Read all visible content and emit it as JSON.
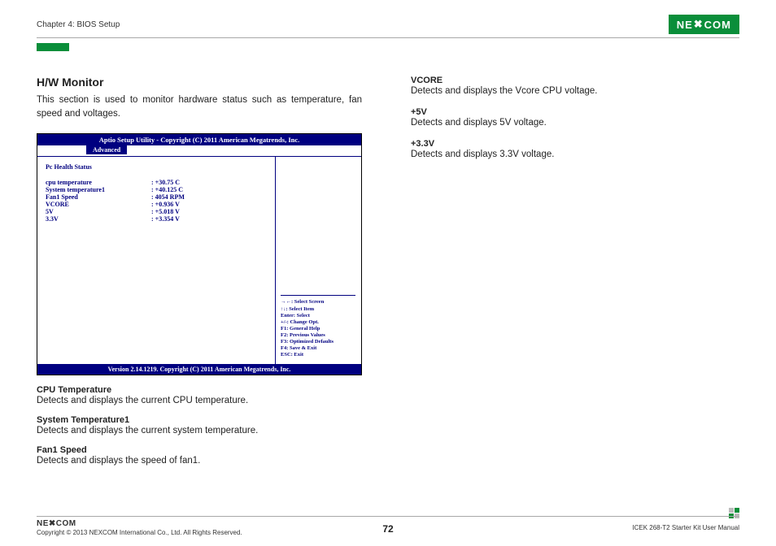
{
  "header": {
    "chapter": "Chapter 4: BIOS Setup",
    "logo_text": "NE COM",
    "logo_x": "✖"
  },
  "main": {
    "section_title": "H/W Monitor",
    "intro": "This section is used to monitor hardware status such as temperature, fan speed and voltages."
  },
  "bios": {
    "title": "Aptio Setup Utility - Copyright (C) 2011 American Megatrends, Inc.",
    "tab": "Advanced",
    "status_header": "Pc Health Status",
    "rows": [
      {
        "label": "cpu temperature",
        "value": ":  +30.75 C"
      },
      {
        "label": "System temperature1",
        "value": ":  +40.125 C"
      },
      {
        "label": "Fan1 Speed",
        "value": ":  4054 RPM"
      },
      {
        "label": "VCORE",
        "value": ":  +0.936 V"
      },
      {
        "label": "5V",
        "value": ":  +5.018 V"
      },
      {
        "label": "3.3V",
        "value": ":  +3.354 V"
      }
    ],
    "help": [
      "→←: Select Screen",
      "↑↓: Select Item",
      "Enter: Select",
      "+/-: Change Opt.",
      "F1: General Help",
      "F2: Previous Values",
      "F3: Optimized Defaults",
      "F4: Save & Exit",
      "ESC: Exit"
    ],
    "footer": "Version 2.14.1219. Copyright (C) 2011 American Megatrends, Inc."
  },
  "fields_left": [
    {
      "title": "CPU Temperature",
      "desc": "Detects and displays the current CPU temperature."
    },
    {
      "title": "System Temperature1",
      "desc": "Detects and displays the current system temperature."
    },
    {
      "title": "Fan1 Speed",
      "desc": "Detects and displays the speed of fan1."
    }
  ],
  "fields_right": [
    {
      "title": "VCORE",
      "desc": "Detects and displays the Vcore CPU voltage."
    },
    {
      "title": "+5V",
      "desc": "Detects and displays 5V voltage."
    },
    {
      "title": "+3.3V",
      "desc": "Detects and displays 3.3V voltage."
    }
  ],
  "footer": {
    "logo_small": "NE✖COM",
    "copyright": "Copyright © 2013 NEXCOM International Co., Ltd. All Rights Reserved.",
    "page_num": "72",
    "manual": "ICEK 268-T2 Starter Kit User Manual"
  }
}
